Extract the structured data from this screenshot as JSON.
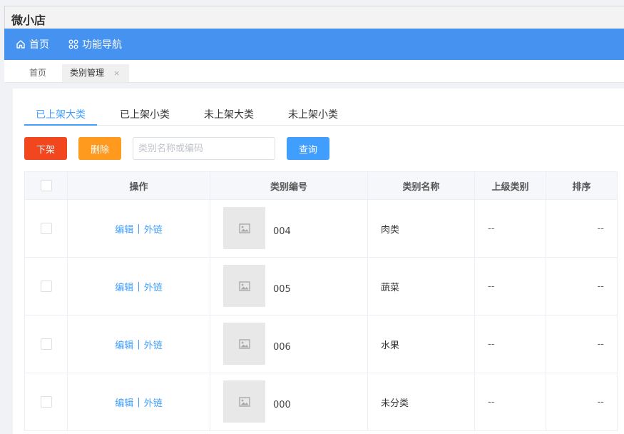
{
  "app": {
    "title": "微小店"
  },
  "nav": {
    "home": "首页",
    "functions": "功能导航"
  },
  "page_tabs": {
    "home": "首页",
    "current": "类别管理",
    "close": "×"
  },
  "sub_tabs": [
    "已上架大类",
    "已上架小类",
    "未上架大类",
    "未上架小类"
  ],
  "toolbar": {
    "offshelf": "下架",
    "delete": "删除",
    "search_placeholder": "类别名称或编码",
    "query": "查询"
  },
  "table": {
    "headers": {
      "op": "操作",
      "code": "类别编号",
      "name": "类别名称",
      "parent": "上级类别",
      "sort": "排序"
    },
    "op_edit": "编辑",
    "op_sep": "|",
    "op_link": "外链",
    "rows": [
      {
        "code": "004",
        "name": "肉类",
        "parent": "--",
        "sort": "--"
      },
      {
        "code": "005",
        "name": "蔬菜",
        "parent": "--",
        "sort": "--"
      },
      {
        "code": "006",
        "name": "水果",
        "parent": "--",
        "sort": "--"
      },
      {
        "code": "000",
        "name": "未分类",
        "parent": "--",
        "sort": "--"
      }
    ]
  },
  "icons": {
    "home": "home-icon",
    "functions": "grid-apps-icon",
    "thumbnail": "image-placeholder-icon"
  },
  "colors": {
    "nav": "#4592f0",
    "primary": "#409eff",
    "danger": "#f2461f",
    "warning": "#ff9a1f"
  }
}
